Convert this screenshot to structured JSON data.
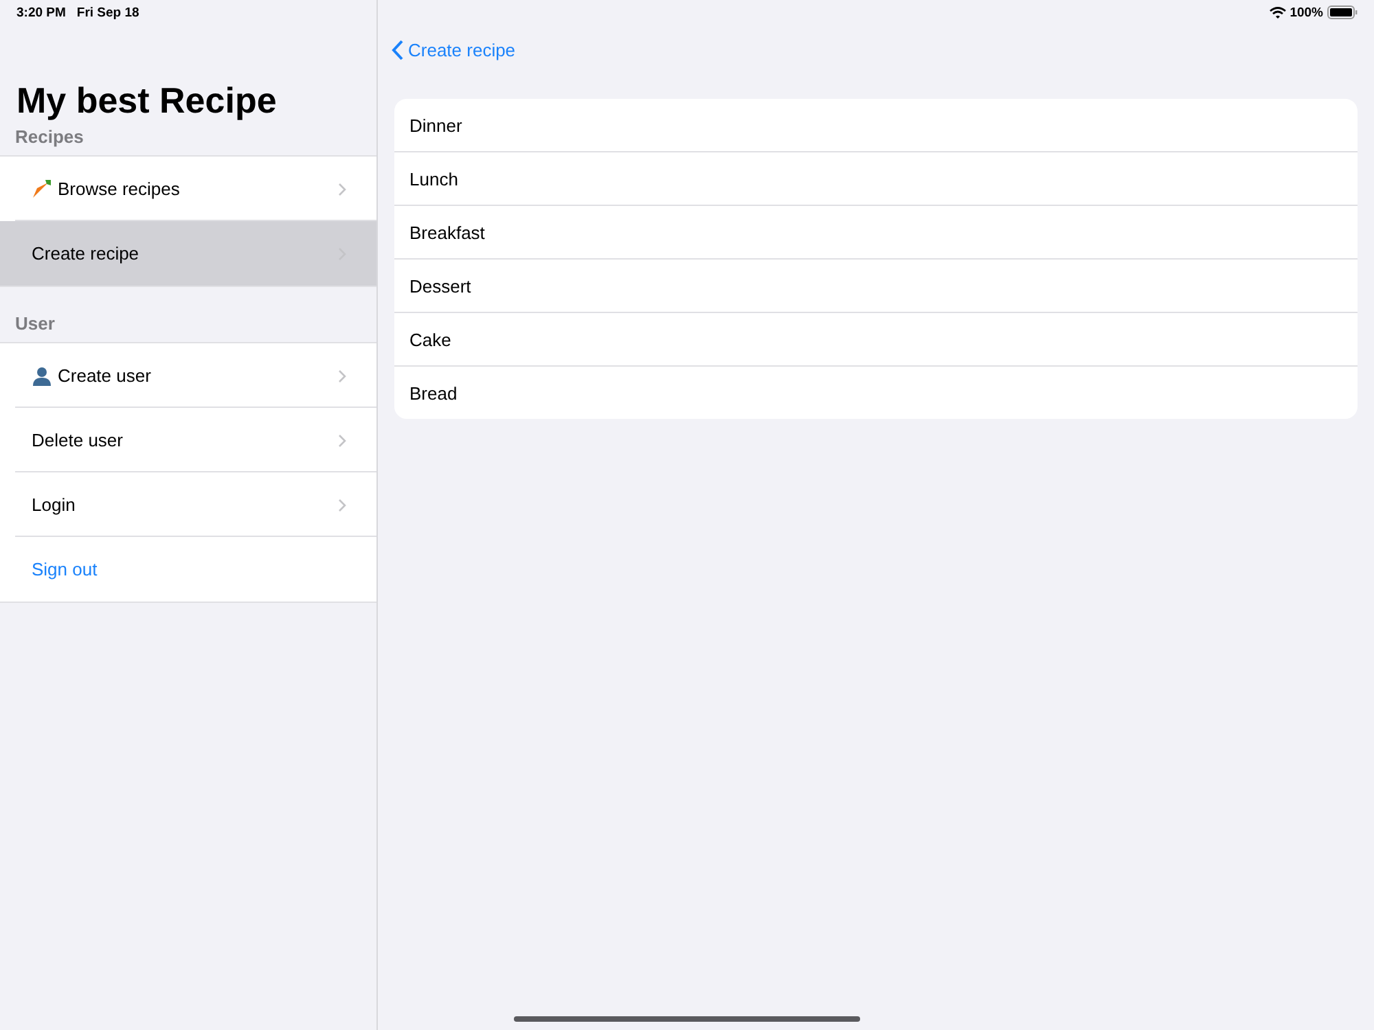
{
  "status_bar": {
    "time": "3:20 PM",
    "date": "Fri Sep 18",
    "battery": "100%"
  },
  "sidebar": {
    "title": "My best Recipe",
    "sections": [
      {
        "header": "Recipes",
        "items": [
          {
            "label": "Browse recipes",
            "kind": "carrot",
            "selected": false
          },
          {
            "label": "Create recipe",
            "kind": "plain",
            "selected": true
          }
        ]
      },
      {
        "header": "User",
        "items": [
          {
            "label": "Create user",
            "kind": "person",
            "selected": false
          },
          {
            "label": "Delete user",
            "kind": "plain",
            "selected": false
          },
          {
            "label": "Login",
            "kind": "plain",
            "selected": false
          },
          {
            "label": "Sign out",
            "kind": "action",
            "selected": false
          }
        ]
      }
    ]
  },
  "detail": {
    "back": "Create recipe",
    "items": [
      "Dinner",
      "Lunch",
      "Breakfast",
      "Dessert",
      "Cake",
      "Bread"
    ]
  }
}
